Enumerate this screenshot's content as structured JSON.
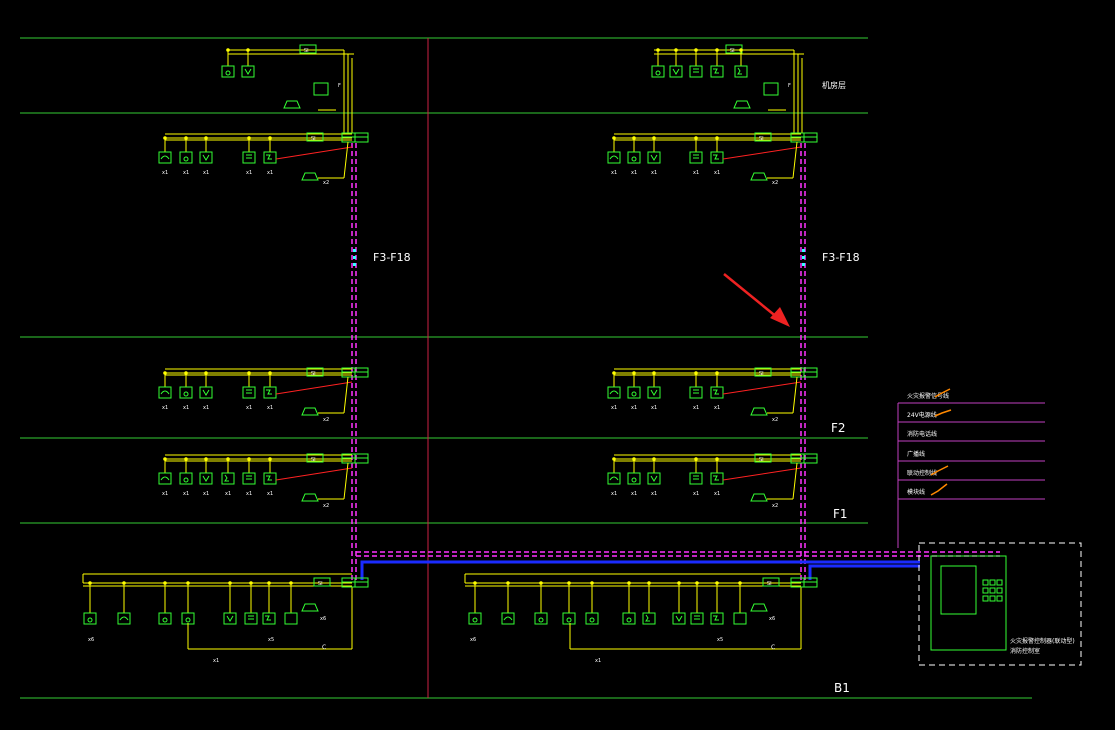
{
  "floor_labels": {
    "f3_f18_left": "F3-F18",
    "f3_f18_right": "F3-F18",
    "machine_room": "机房层",
    "f2": "F2",
    "f1": "F1",
    "b1": "B1"
  },
  "control_panel_caption": "火灾报警控制器(联动型)",
  "panel_sub_caption": "消防控制室",
  "legend_items": [
    "火灾报警信号线",
    "24V电源线",
    "消防电话线",
    "广播线",
    "联动控制线",
    "模块线"
  ],
  "wire_tags": {
    "si": "SI",
    "f": "F",
    "c": "C",
    "x1": "x1",
    "x2": "x2",
    "x5": "x5",
    "x6": "x6"
  },
  "colors": {
    "background": "#000000",
    "floor_line": "#33cc33",
    "bus_yellow": "#ffff00",
    "device_green": "#33ff33",
    "riser_magenta": "#ff33ff",
    "divider_red": "#cc2244",
    "signal_red": "#ff2222",
    "trunk_blue": "#1a2bff",
    "legend_purple": "#c040c0",
    "annotation_arrow": "#ee2222",
    "legend_check": "#ff8800",
    "dots_cyan": "#33ffff"
  }
}
